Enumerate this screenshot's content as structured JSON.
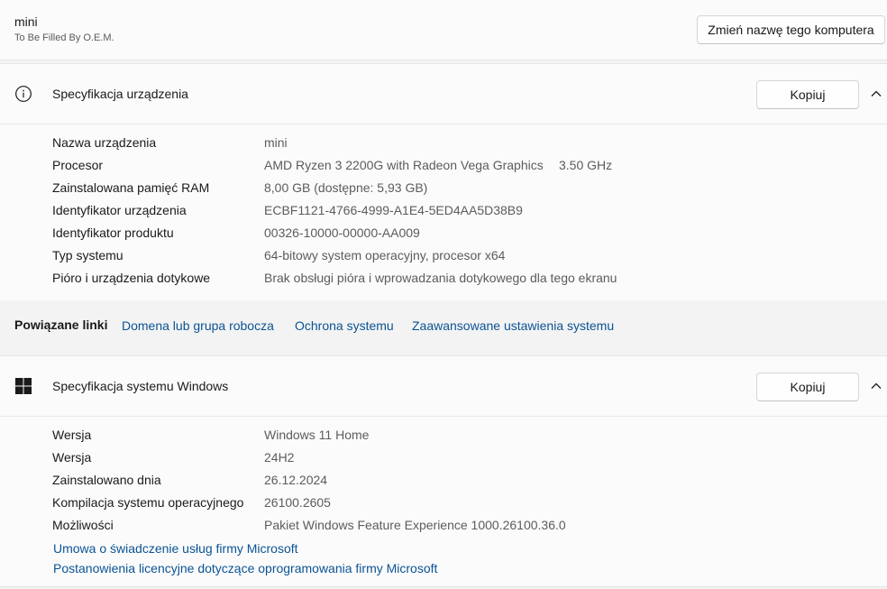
{
  "device": {
    "name": "mini",
    "manufacturer": "To Be Filled By O.E.M.",
    "rename_label": "Zmień nazwę tego komputera"
  },
  "device_spec": {
    "title": "Specyfikacja urządzenia",
    "copy_label": "Kopiuj",
    "rows": [
      {
        "label": "Nazwa urządzenia",
        "value": "mini",
        "extra": ""
      },
      {
        "label": "Procesor",
        "value": "AMD Ryzen 3 2200G with Radeon Vega Graphics",
        "extra": "3.50 GHz"
      },
      {
        "label": "Zainstalowana pamięć RAM",
        "value": "8,00 GB (dostępne: 5,93 GB)",
        "extra": ""
      },
      {
        "label": "Identyfikator urządzenia",
        "value": "ECBF1121-4766-4999-A1E4-5ED4AA5D38B9",
        "extra": ""
      },
      {
        "label": "Identyfikator produktu",
        "value": "00326-10000-00000-AA009",
        "extra": ""
      },
      {
        "label": "Typ systemu",
        "value": "64-bitowy system operacyjny, procesor x64",
        "extra": ""
      },
      {
        "label": "Pióro i urządzenia dotykowe",
        "value": "Brak obsługi pióra i wprowadzania dotykowego dla tego ekranu",
        "extra": ""
      }
    ]
  },
  "related_links": {
    "title": "Powiązane linki",
    "links": [
      "Domena lub grupa robocza",
      "Ochrona systemu",
      "Zaawansowane ustawienia systemu"
    ]
  },
  "windows_spec": {
    "title": "Specyfikacja systemu Windows",
    "copy_label": "Kopiuj",
    "rows": [
      {
        "label": "Wersja",
        "value": "Windows 11 Home"
      },
      {
        "label": "Wersja",
        "value": "24H2"
      },
      {
        "label": "Zainstalowano dnia",
        "value": "26.12.2024"
      },
      {
        "label": "Kompilacja systemu operacyjnego",
        "value": "26100.2605"
      },
      {
        "label": "Możliwości",
        "value": "Pakiet Windows Feature Experience 1000.26100.36.0"
      }
    ],
    "links": [
      "Umowa o świadczenie usług firmy Microsoft",
      "Postanowienia licencyjne dotyczące oprogramowania firmy Microsoft"
    ]
  },
  "colors": {
    "link": "#0b5394",
    "background": "#f3f3f3",
    "card": "#fbfbfb"
  },
  "icons": {
    "info": "info-icon",
    "windows": "windows-logo-icon",
    "chevron": "chevron-up-icon"
  }
}
